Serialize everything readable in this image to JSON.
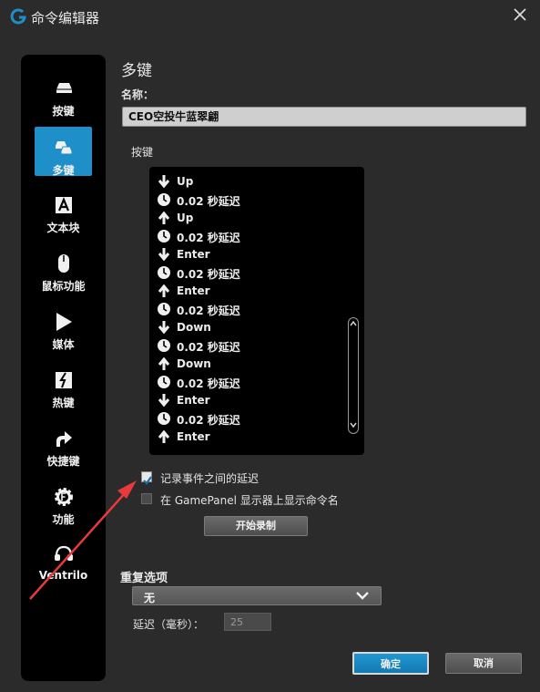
{
  "window": {
    "title": "命令编辑器"
  },
  "sidebar": {
    "items": [
      {
        "label": "按键",
        "icon": "key-icon",
        "active": false
      },
      {
        "label": "多键",
        "icon": "multi-key-icon",
        "active": true
      },
      {
        "label": "文本块",
        "icon": "text-block-icon",
        "active": false
      },
      {
        "label": "鼠标功能",
        "icon": "mouse-icon",
        "active": false
      },
      {
        "label": "媒体",
        "icon": "play-icon",
        "active": false
      },
      {
        "label": "热键",
        "icon": "hotkey-icon",
        "active": false
      },
      {
        "label": "快捷键",
        "icon": "shortcut-arrow-icon",
        "active": false
      },
      {
        "label": "功能",
        "icon": "function-gear-icon",
        "active": false
      },
      {
        "label": "Ventrilo",
        "icon": "headset-icon",
        "active": false
      }
    ]
  },
  "main": {
    "section_title": "多键",
    "name_label": "名称：",
    "name_value": "CEO空投牛蓝翠翩",
    "keys_label": "按键",
    "keys": [
      {
        "type": "down",
        "text": "Up"
      },
      {
        "type": "delay",
        "text": "0.02 秒延迟"
      },
      {
        "type": "up",
        "text": "Up"
      },
      {
        "type": "delay",
        "text": "0.02 秒延迟"
      },
      {
        "type": "down",
        "text": "Enter"
      },
      {
        "type": "delay",
        "text": "0.02 秒延迟"
      },
      {
        "type": "up",
        "text": "Enter"
      },
      {
        "type": "delay",
        "text": "0.02 秒延迟"
      },
      {
        "type": "down",
        "text": "Down"
      },
      {
        "type": "delay",
        "text": "0.02 秒延迟"
      },
      {
        "type": "up",
        "text": "Down"
      },
      {
        "type": "delay",
        "text": "0.02 秒延迟"
      },
      {
        "type": "down",
        "text": "Enter"
      },
      {
        "type": "delay",
        "text": "0.02 秒延迟"
      },
      {
        "type": "up",
        "text": "Enter"
      }
    ],
    "record_delay_label": "记录事件之间的延迟",
    "record_delay_checked": true,
    "gamepanel_label": "在 GamePanel 显示器上显示命令名",
    "gamepanel_checked": false,
    "start_record_label": "开始录制",
    "repeat_title": "重复选项",
    "repeat_value": "无",
    "delay_label": "延迟（毫秒）：",
    "delay_value": "25"
  },
  "footer": {
    "ok_label": "确定",
    "cancel_label": "取消"
  },
  "colors": {
    "accent": "#1e8fc8",
    "annotation_arrow": "#e8393c"
  }
}
